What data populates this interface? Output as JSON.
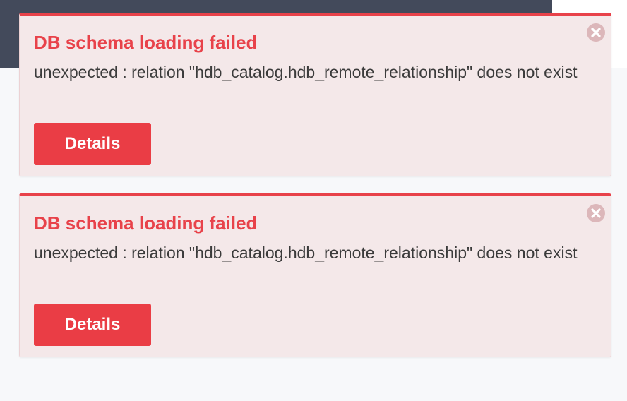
{
  "notifications": [
    {
      "title": "DB schema loading failed",
      "message": "unexpected : relation \"hdb_catalog.hdb_remote_relationship\" does not exist",
      "details_label": "Details",
      "close_icon": "close-circle-icon"
    },
    {
      "title": "DB schema loading failed",
      "message": "unexpected : relation \"hdb_catalog.hdb_remote_relationship\" does not exist",
      "details_label": "Details",
      "close_icon": "close-circle-icon"
    }
  ],
  "colors": {
    "header_background": "#434a5b",
    "page_background": "#f7f8fa",
    "toast_background": "#f4e8e9",
    "accent_red": "#e8424a",
    "button_red": "#ea3d45",
    "close_icon": "#dcb7ba"
  }
}
